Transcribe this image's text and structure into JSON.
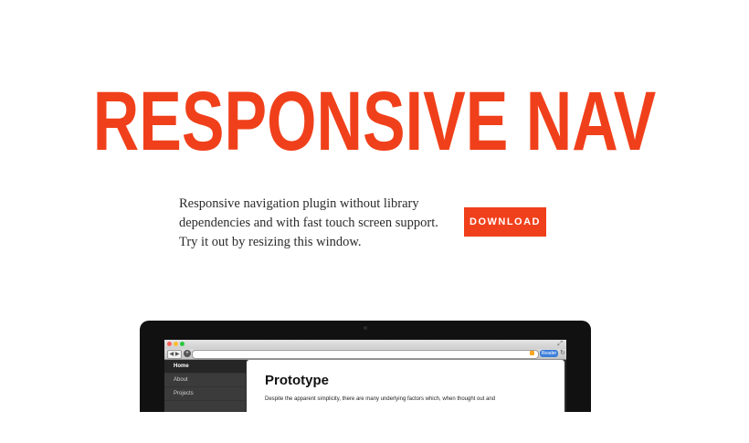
{
  "hero": {
    "title": "RESPONSIVE NAV"
  },
  "intro": {
    "lines": [
      "Responsive navigation plugin without library",
      "dependencies and with fast touch screen support.",
      "Try it out by resizing this window."
    ]
  },
  "download": {
    "label": "DOWNLOAD"
  },
  "colors": {
    "accent": "#f0401b",
    "text": "#2b2b2b",
    "background": "#ffffff"
  },
  "mockup": {
    "browser": {
      "reader_label": "Reader",
      "icons": [
        "close-icon",
        "minimize-icon",
        "maximize-icon",
        "back-forward-icon",
        "site-icon",
        "rss-icon",
        "refresh-icon"
      ]
    },
    "sidebar": {
      "items": [
        {
          "label": "Home",
          "active": true
        },
        {
          "label": "About",
          "active": false
        },
        {
          "label": "Projects",
          "active": false
        }
      ]
    },
    "page": {
      "title": "Prototype",
      "text": "Despite the apparent simplicity, there are many underlying factors which, when thought out and"
    }
  }
}
